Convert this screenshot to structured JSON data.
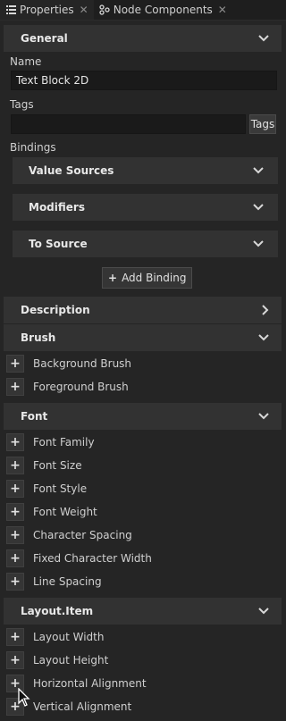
{
  "tabs": [
    {
      "label": "Properties",
      "icon": "list-icon",
      "active": true
    },
    {
      "label": "Node Components",
      "icon": "nodes-icon",
      "active": false
    }
  ],
  "general": {
    "title": "General",
    "name_label": "Name",
    "name_value": "Text Block 2D",
    "tags_label": "Tags",
    "tags_value": "",
    "tags_button": "Tags",
    "bindings_label": "Bindings",
    "bindings": [
      "Value Sources",
      "Modifiers",
      "To Source"
    ],
    "add_binding": "Add Binding"
  },
  "description": {
    "title": "Description"
  },
  "brush": {
    "title": "Brush",
    "items": [
      "Background Brush",
      "Foreground Brush"
    ]
  },
  "font": {
    "title": "Font",
    "items": [
      "Font Family",
      "Font Size",
      "Font Style",
      "Font Weight",
      "Character Spacing",
      "Fixed Character Width",
      "Line Spacing"
    ]
  },
  "layout": {
    "title": "Layout.Item",
    "items": [
      "Layout Width",
      "Layout Height",
      "Horizontal Alignment",
      "Vertical Alignment"
    ]
  }
}
